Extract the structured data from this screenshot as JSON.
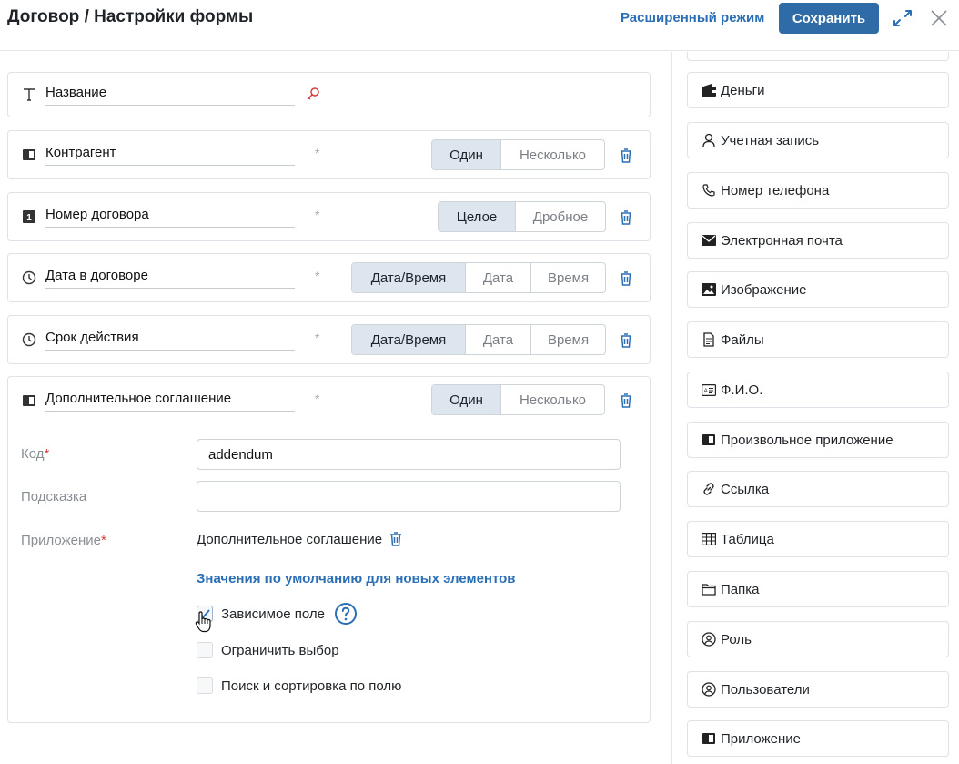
{
  "header": {
    "title": "Договор / Настройки формы",
    "advanced_mode": "Расширенный режим",
    "save": "Сохранить"
  },
  "fields": [
    {
      "name": "Название",
      "icon": "text-icon",
      "key": true
    },
    {
      "name": "Контрагент",
      "icon": "app-icon",
      "options": [
        "Один",
        "Несколько"
      ],
      "active": 0
    },
    {
      "name": "Номер договора",
      "icon": "number-icon",
      "options": [
        "Целое",
        "Дробное"
      ],
      "active": 0
    },
    {
      "name": "Дата в договоре",
      "icon": "clock-icon",
      "options": [
        "Дата/Время",
        "Дата",
        "Время"
      ],
      "active": 0
    },
    {
      "name": "Срок действия",
      "icon": "clock-icon",
      "options": [
        "Дата/Время",
        "Дата",
        "Время"
      ],
      "active": 0
    },
    {
      "name": "Дополнительное соглашение",
      "icon": "app-icon",
      "options": [
        "Один",
        "Несколько"
      ],
      "active": 0
    }
  ],
  "star": "*",
  "expanded": {
    "code_label": "Код",
    "code_value": "addendum",
    "hint_label": "Подсказка",
    "hint_value": "",
    "app_label": "Приложение",
    "app_value": "Дополнительное соглашение",
    "required_mark": "*",
    "defaults_link": "Значения по умолчанию для новых элементов",
    "checkboxes": [
      {
        "label": "Зависимое поле",
        "checked": true,
        "help": true
      },
      {
        "label": "Ограничить выбор",
        "checked": false
      },
      {
        "label": "Поиск и сортировка по полю",
        "checked": false
      }
    ]
  },
  "types": [
    {
      "label": "Деньги",
      "icon": "wallet-icon"
    },
    {
      "label": "Учетная запись",
      "icon": "user-icon"
    },
    {
      "label": "Номер телефона",
      "icon": "phone-icon"
    },
    {
      "label": "Электронная почта",
      "icon": "mail-icon"
    },
    {
      "label": "Изображение",
      "icon": "image-icon"
    },
    {
      "label": "Файлы",
      "icon": "file-icon"
    },
    {
      "label": "Ф.И.О.",
      "icon": "id-card-icon"
    },
    {
      "label": "Произвольное приложение",
      "icon": "app-icon"
    },
    {
      "label": "Ссылка",
      "icon": "link-icon"
    },
    {
      "label": "Таблица",
      "icon": "table-icon"
    },
    {
      "label": "Папка",
      "icon": "folder-icon"
    },
    {
      "label": "Роль",
      "icon": "role-icon"
    },
    {
      "label": "Пользователи",
      "icon": "users-icon"
    },
    {
      "label": "Приложение",
      "icon": "app-icon"
    }
  ],
  "colors": {
    "accent": "#2f6ca7",
    "link": "#2a6fb5",
    "segment_active": "#dde6ef",
    "required": "#d63c3c"
  }
}
